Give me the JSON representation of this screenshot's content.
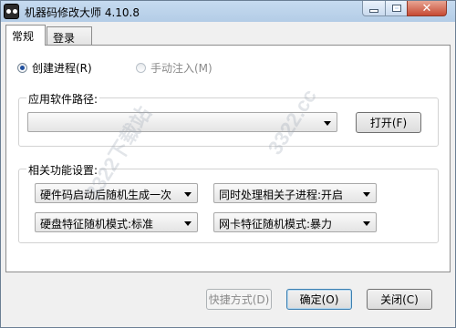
{
  "window": {
    "title": "机器码修改大师 4.10.8"
  },
  "tabs": [
    {
      "label": "常规"
    },
    {
      "label": "登录"
    }
  ],
  "mode": {
    "create_process": {
      "label": "创建进程(R)",
      "checked": true
    },
    "manual_inject": {
      "label": "手动注入(M)",
      "checked": false,
      "disabled": true
    }
  },
  "path_group": {
    "label": "应用软件路径:",
    "path_value": "",
    "open_button": "打开(F)"
  },
  "functions_group": {
    "label": "相关功能设置:",
    "combos": [
      {
        "value": "硬件码启动后随机生成一次"
      },
      {
        "value": "同时处理相关子进程:开启"
      },
      {
        "value": "硬盘特征随机模式:标准"
      },
      {
        "value": "网卡特征随机模式:暴力"
      }
    ]
  },
  "footer": {
    "shortcut_button": "快捷方式(D)",
    "ok_button": "确定(O)",
    "close_button": "关闭(C)"
  },
  "watermark": {
    "text": "3322下载站",
    "domain": "3322.cc"
  }
}
